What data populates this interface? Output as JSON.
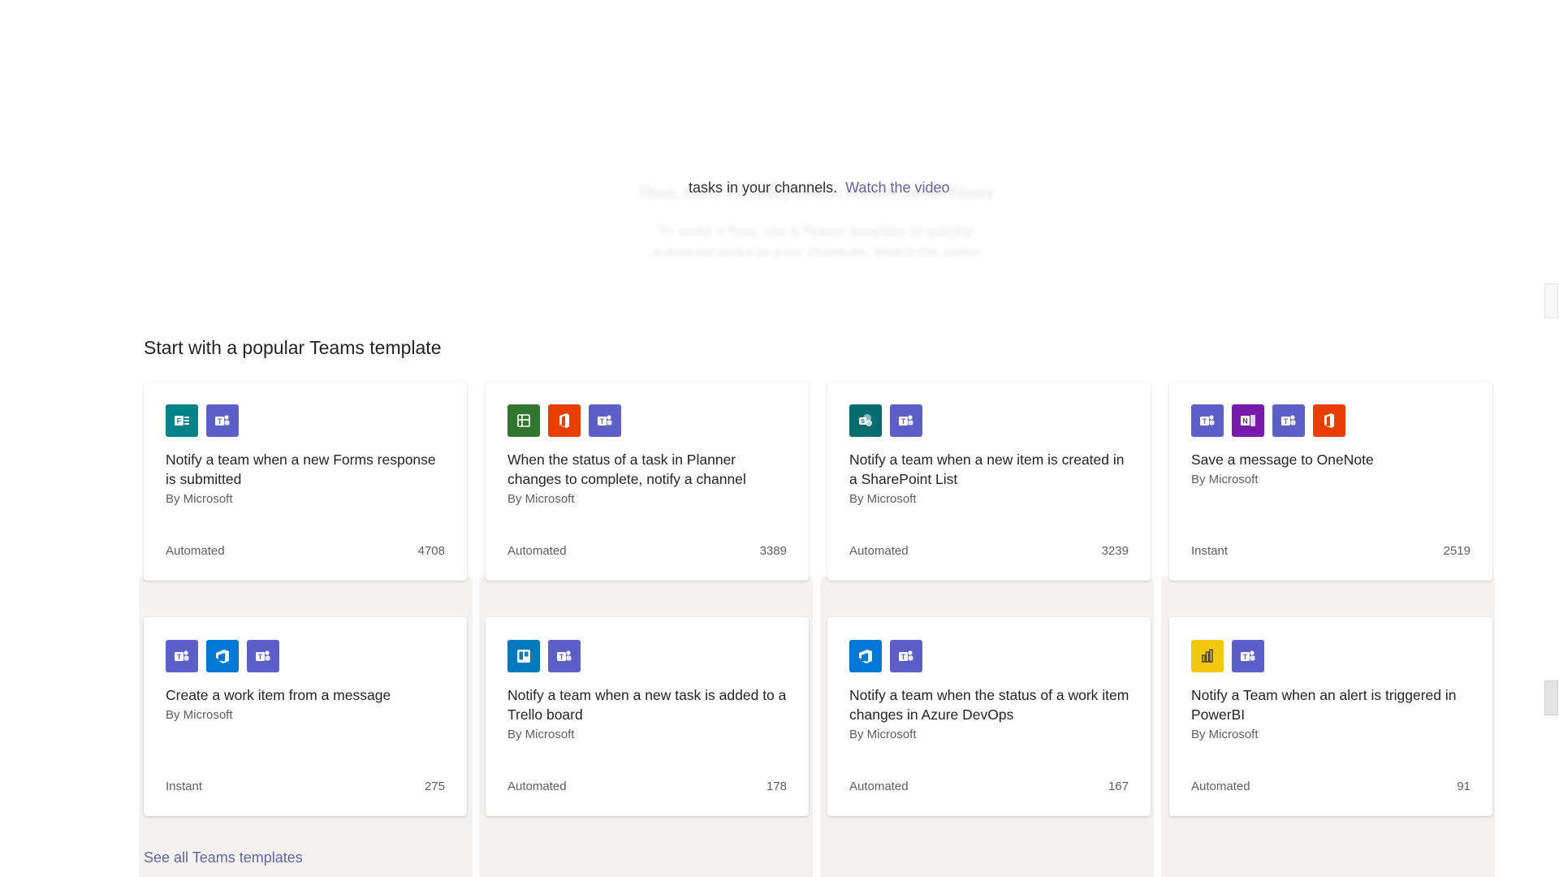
{
  "intro": {
    "text": "tasks in your channels.",
    "link": "Watch the video",
    "ghost_heading": "Then, there's a really useful section about Flows",
    "ghost_body": "To make a flow, use a Teams template to quickly automate tasks in your channels. Watch the video"
  },
  "section": {
    "title": "Start with a popular Teams template",
    "see_all": "See all Teams templates"
  },
  "colors": {
    "teams": "#5b5fc7",
    "forms": "#038387",
    "planner": "#31752f",
    "office": "#e83e00",
    "sharepoint": "#036c70",
    "onenote": "#7719aa",
    "azure_devops": "#0078d4",
    "trello": "#0079bf",
    "powerbi": "#f2c811",
    "link": "#6264a7"
  },
  "cards": [
    {
      "icons": [
        "forms-icon",
        "teams-icon"
      ],
      "title": "Notify a team when a new Forms response is submitted",
      "author": "By Microsoft",
      "type": "Automated",
      "count": "4708"
    },
    {
      "icons": [
        "planner-icon",
        "office-icon",
        "teams-icon"
      ],
      "title": "When the status of a task in Planner changes to complete, notify a channel",
      "author": "By Microsoft",
      "type": "Automated",
      "count": "3389"
    },
    {
      "icons": [
        "sharepoint-icon",
        "teams-icon"
      ],
      "title": "Notify a team when a new item is created in a SharePoint List",
      "author": "By Microsoft",
      "type": "Automated",
      "count": "3239"
    },
    {
      "icons": [
        "teams-icon",
        "onenote-icon",
        "teams-icon",
        "office-icon"
      ],
      "title": "Save a message to OneNote",
      "author": "By Microsoft",
      "type": "Instant",
      "count": "2519"
    },
    {
      "icons": [
        "teams-icon",
        "azure-devops-icon",
        "teams-icon"
      ],
      "title": "Create a work item from a message",
      "author": "By Microsoft",
      "type": "Instant",
      "count": "275"
    },
    {
      "icons": [
        "trello-icon",
        "teams-icon"
      ],
      "title": "Notify a team when a new task is added to a Trello board",
      "author": "By Microsoft",
      "type": "Automated",
      "count": "178"
    },
    {
      "icons": [
        "azure-devops-icon",
        "teams-icon"
      ],
      "title": "Notify a team when the status of a work item changes in Azure DevOps",
      "author": "By Microsoft",
      "type": "Automated",
      "count": "167"
    },
    {
      "icons": [
        "powerbi-icon",
        "teams-icon"
      ],
      "title": "Notify a Team when an alert is triggered in PowerBI",
      "author": "By Microsoft",
      "type": "Automated",
      "count": "91"
    }
  ]
}
